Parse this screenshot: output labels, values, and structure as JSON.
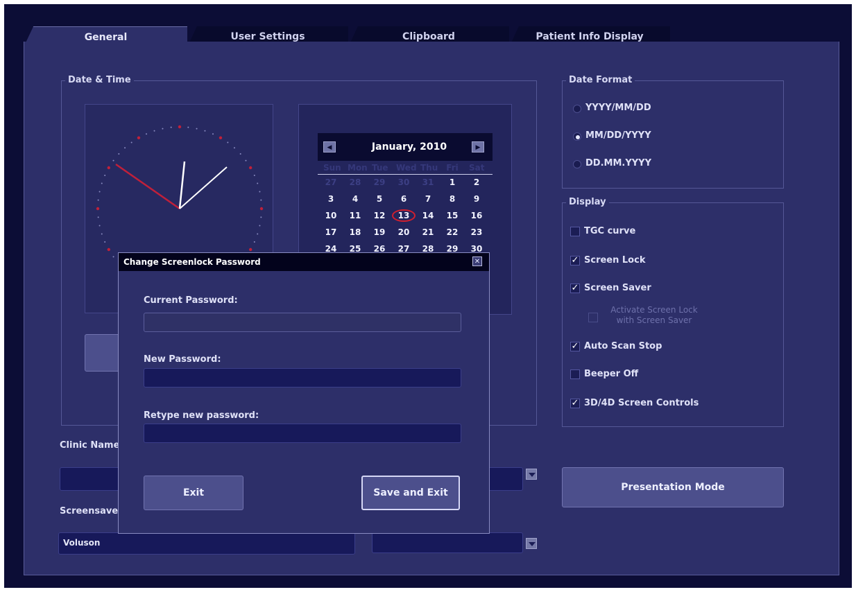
{
  "tabs": [
    "General",
    "User Settings",
    "Clipboard",
    "Patient Info Display"
  ],
  "date_time": {
    "legend": "Date & Time",
    "calendar": {
      "month_year": "January, 2010",
      "weekdays": [
        "Sun",
        "Mon",
        "Tue",
        "Wed",
        "Thu",
        "Fri",
        "Sat"
      ],
      "weeks": [
        [
          "27",
          "28",
          "29",
          "30",
          "31",
          "1",
          "2"
        ],
        [
          "3",
          "4",
          "5",
          "6",
          "7",
          "8",
          "9"
        ],
        [
          "10",
          "11",
          "12",
          "13",
          "14",
          "15",
          "16"
        ],
        [
          "17",
          "18",
          "19",
          "20",
          "21",
          "22",
          "23"
        ],
        [
          "24",
          "25",
          "26",
          "27",
          "28",
          "29",
          "30"
        ]
      ],
      "selected_day": "13",
      "prev_icon": "chevron-left-icon",
      "next_icon": "chevron-right-icon"
    }
  },
  "date_format": {
    "legend": "Date Format",
    "options": [
      {
        "label": "YYYY/MM/DD",
        "checked": false
      },
      {
        "label": "MM/DD/YYYY",
        "checked": true
      },
      {
        "label": "DD.MM.YYYY",
        "checked": false
      }
    ]
  },
  "display": {
    "legend": "Display",
    "options": [
      {
        "label": "TGC curve",
        "checked": false
      },
      {
        "label": "Screen Lock",
        "checked": true
      },
      {
        "label": "Screen Saver",
        "checked": true
      },
      {
        "label": "Activate Screen Lock with Screen Saver",
        "checked": false,
        "disabled": true
      },
      {
        "label": "Auto Scan Stop",
        "checked": true
      },
      {
        "label": "Beeper Off",
        "checked": false
      },
      {
        "label": "3D/4D Screen Controls",
        "checked": true
      }
    ]
  },
  "presentation_mode_label": "Presentation Mode",
  "clinic_name": {
    "label": "Clinic Name",
    "value": ""
  },
  "screensaver": {
    "label": "Screensave",
    "value": "Voluson"
  },
  "dialog": {
    "title": "Change Screenlock Password",
    "current_password_label": "Current Password:",
    "new_password_label": "New Password:",
    "retype_password_label": "Retype new password:",
    "exit_label": "Exit",
    "save_label": "Save and Exit"
  },
  "colors": {
    "background": "#2d2f69",
    "clock_hand_red": "#c0203a",
    "selected_day_ring": "#d01f2f"
  }
}
